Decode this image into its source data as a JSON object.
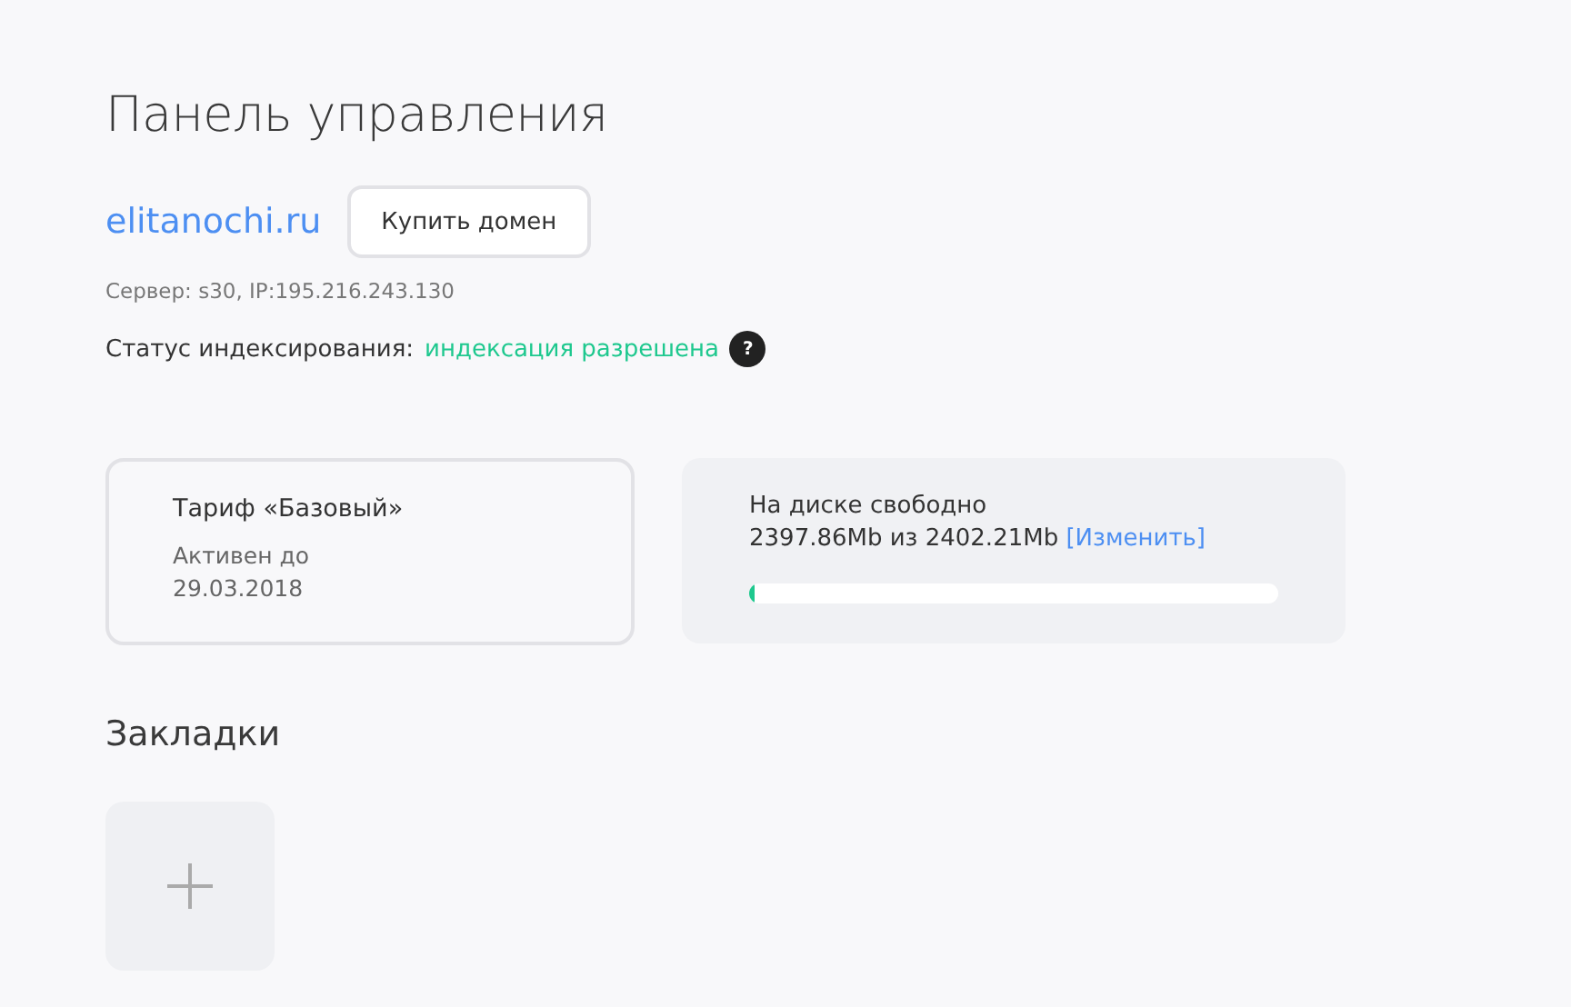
{
  "title": "Панель управления",
  "domain": {
    "name": "elitanochi.ru",
    "button": "Купить домен"
  },
  "server": "Сервер: s30, IP:195.216.243.130",
  "indexing": {
    "label": "Статус индексирования:",
    "value": "индексация разрешена",
    "help": "?"
  },
  "tariff": {
    "name": "Тариф «Базовый»",
    "active_label": "Активен до",
    "date": "29.03.2018"
  },
  "disk": {
    "label": "На диске свободно",
    "usage": "2397.86Mb из 2402.21Mb",
    "link": "[Изменить]",
    "level": 0.01
  },
  "bookmarks": {
    "title": "Закладки"
  }
}
